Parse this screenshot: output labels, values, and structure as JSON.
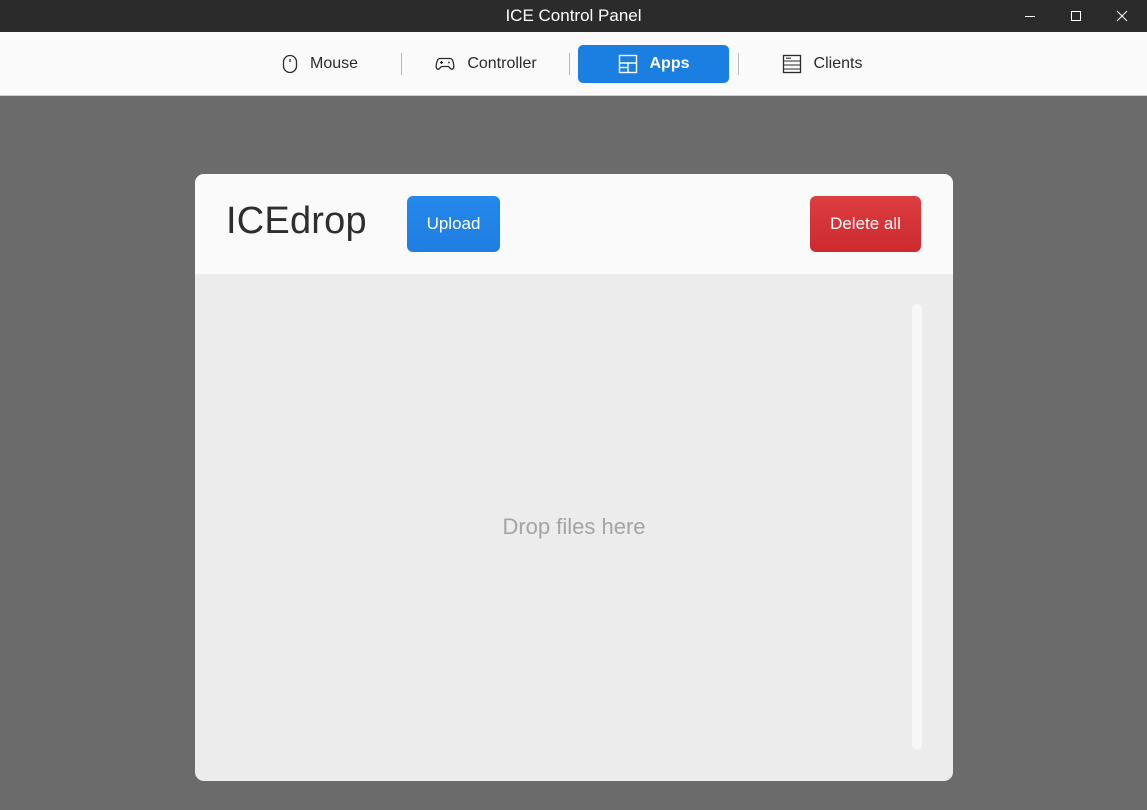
{
  "window": {
    "title": "ICE Control Panel"
  },
  "nav": {
    "tabs": [
      {
        "label": "Mouse",
        "icon": "mouse-icon"
      },
      {
        "label": "Controller",
        "icon": "gamepad-icon"
      },
      {
        "label": "Apps",
        "icon": "apps-layout-icon",
        "active": true
      },
      {
        "label": "Clients",
        "icon": "server-icon"
      }
    ]
  },
  "icedrop": {
    "title": "ICEdrop",
    "upload_label": "Upload",
    "delete_all_label": "Delete all",
    "drop_hint": "Drop files here"
  },
  "colors": {
    "accent": "#1a7fe0",
    "danger": "#cc2a2e",
    "titlebar": "#2b2b2b",
    "backdrop": "#6b6b6b"
  }
}
